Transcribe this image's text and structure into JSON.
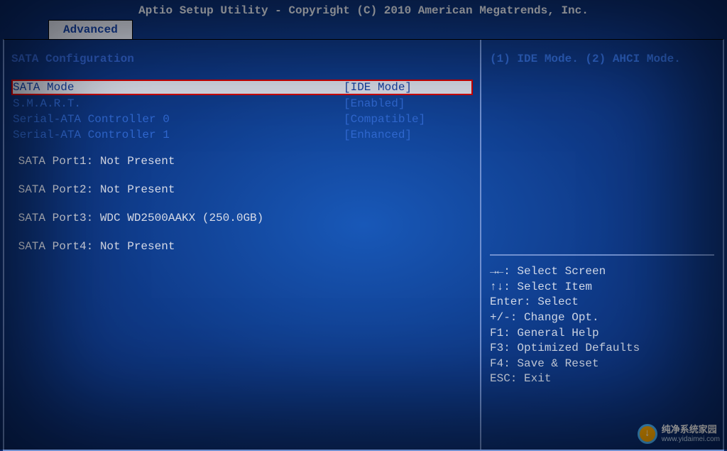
{
  "header": {
    "title": "Aptio Setup Utility - Copyright (C) 2010 American Megatrends, Inc."
  },
  "tabs": {
    "active": "Advanced"
  },
  "main": {
    "section_title": "SATA Configuration",
    "items": [
      {
        "label": "SATA Mode",
        "value": "[IDE Mode]",
        "highlighted": true,
        "interactable": true
      },
      {
        "label": "S.M.A.R.T.",
        "value": "[Enabled]",
        "submenu": true,
        "interactable": true
      },
      {
        "label": "Serial-ATA Controller 0",
        "value": "[Compatible]",
        "submenu": true,
        "interactable": true
      },
      {
        "label": "Serial-ATA Controller 1",
        "value": "[Enhanced]",
        "submenu": true,
        "interactable": true
      }
    ],
    "ports": [
      {
        "text": " SATA Port1: Not Present"
      },
      {
        "text": " SATA Port2: Not Present"
      },
      {
        "text": " SATA Port3: WDC WD2500AAKX (250.0GB)"
      },
      {
        "text": " SATA Port4: Not Present"
      }
    ]
  },
  "help": {
    "description": "(1) IDE Mode. (2) AHCI Mode.",
    "keys": [
      "→←: Select Screen",
      "↑↓: Select Item",
      "Enter: Select",
      "+/-: Change Opt.",
      "F1: General Help",
      "F3: Optimized Defaults",
      "F4: Save & Reset",
      "ESC: Exit"
    ]
  },
  "watermark": {
    "cn": "纯净系统家园",
    "url": "www.yidaimei.com"
  }
}
